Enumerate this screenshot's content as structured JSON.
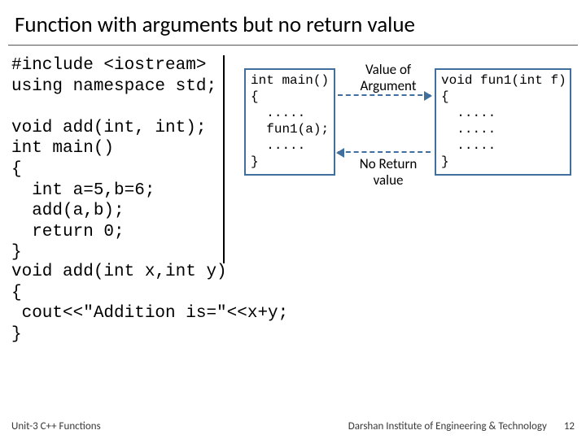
{
  "title": "Function with arguments but no return value",
  "code_left_top": "#include <iostream>\nusing namespace std;\n\nvoid add(int, int);\nint main()\n{\n  int a=5,b=6;\n  add(a,b);\n  return 0;\n}",
  "code_left_bottom": "void add(int x,int y)\n{\n cout<<\"Addition is=\"<<x+y;\n}",
  "box_main": "int main()\n{\n  .....\n  fun1(a);\n  .....\n}",
  "box_fun": "void fun1(int f)\n{\n  .....\n  .....\n  .....\n}",
  "label_arg": "Value of\nArgument",
  "label_ret": "No Return\nvalue",
  "footer_left": "Unit-3 C++ Functions",
  "footer_right": "Darshan Institute of Engineering & Technology",
  "page_num": "12"
}
